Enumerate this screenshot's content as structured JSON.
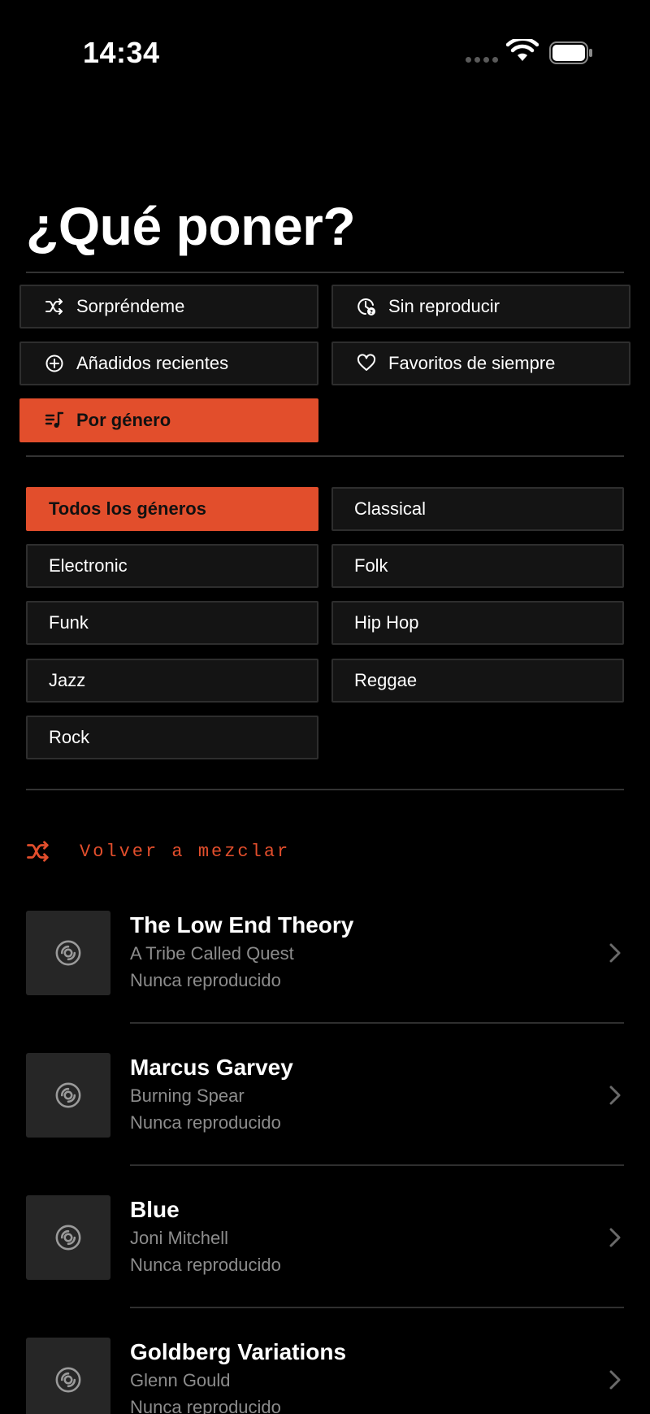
{
  "status_bar": {
    "time": "14:34"
  },
  "page": {
    "title": "¿Qué poner?"
  },
  "filters": [
    {
      "label": "Sorpréndeme",
      "icon": "shuffle-icon",
      "active": false
    },
    {
      "label": "Sin reproducir",
      "icon": "clock-question-icon",
      "active": false
    },
    {
      "label": "Añadidos recientes",
      "icon": "plus-circle-icon",
      "active": false
    },
    {
      "label": "Favoritos de siempre",
      "icon": "heart-icon",
      "active": false
    },
    {
      "label": "Por género",
      "icon": "music-list-icon",
      "active": true
    }
  ],
  "genres": [
    {
      "label": "Todos los géneros",
      "active": true
    },
    {
      "label": "Classical",
      "active": false
    },
    {
      "label": "Electronic",
      "active": false
    },
    {
      "label": "Folk",
      "active": false
    },
    {
      "label": "Funk",
      "active": false
    },
    {
      "label": "Hip Hop",
      "active": false
    },
    {
      "label": "Jazz",
      "active": false
    },
    {
      "label": "Reggae",
      "active": false
    },
    {
      "label": "Rock",
      "active": false
    }
  ],
  "reshuffle": {
    "label": "Volver a mezclar",
    "icon": "shuffle-icon"
  },
  "albums": [
    {
      "title": "The Low End Theory",
      "artist": "A Tribe Called Quest",
      "status": "Nunca reproducido"
    },
    {
      "title": "Marcus Garvey",
      "artist": "Burning Spear",
      "status": "Nunca reproducido"
    },
    {
      "title": "Blue",
      "artist": "Joni Mitchell",
      "status": "Nunca reproducido"
    },
    {
      "title": "Goldberg Variations",
      "artist": "Glenn Gould",
      "status": "Nunca reproducido"
    }
  ],
  "colors": {
    "accent": "#e24e2c",
    "background": "#000000",
    "button": "#141414",
    "secondary_text": "#8c8c8c"
  }
}
